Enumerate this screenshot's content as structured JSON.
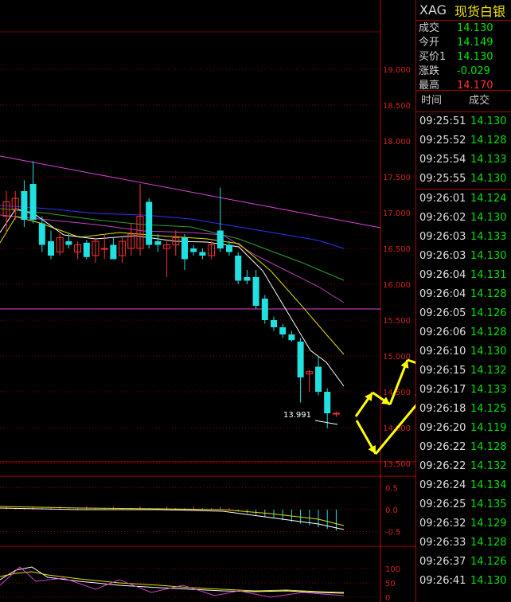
{
  "header": {
    "symbol": "XAG",
    "name": "现货白银"
  },
  "quotes": [
    {
      "label": "成交",
      "value": "14.130",
      "color": "#00e000"
    },
    {
      "label": "今开",
      "value": "14.149",
      "color": "#00e000"
    },
    {
      "label": "买价1",
      "value": "14.130",
      "color": "#00e000"
    },
    {
      "label": "涨跌",
      "value": "-0.029",
      "color": "#00e000"
    },
    {
      "label": "最高",
      "value": "14.170",
      "color": "#ff3030"
    }
  ],
  "ticks_header": {
    "time": "时间",
    "price": "成交"
  },
  "ticks": [
    {
      "time": "09:25:51",
      "price": "14.130"
    },
    {
      "time": "09:25:52",
      "price": "14.128"
    },
    {
      "time": "09:25:54",
      "price": "14.133"
    },
    {
      "time": "09:25:55",
      "price": "14.130"
    },
    {
      "time": "09:26:01",
      "price": "14.124"
    },
    {
      "time": "09:26:02",
      "price": "14.130"
    },
    {
      "time": "09:26:03",
      "price": "14.133"
    },
    {
      "time": "09:26:03",
      "price": "14.130"
    },
    {
      "time": "09:26:04",
      "price": "14.131"
    },
    {
      "time": "09:26:04",
      "price": "14.128"
    },
    {
      "time": "09:26:05",
      "price": "14.126"
    },
    {
      "time": "09:26:06",
      "price": "14.128"
    },
    {
      "time": "09:26:10",
      "price": "14.130"
    },
    {
      "time": "09:26:15",
      "price": "14.132"
    },
    {
      "time": "09:26:17",
      "price": "14.133"
    },
    {
      "time": "09:26:18",
      "price": "14.125"
    },
    {
      "time": "09:26:20",
      "price": "14.119"
    },
    {
      "time": "09:26:22",
      "price": "14.128"
    },
    {
      "time": "09:26:22",
      "price": "14.132"
    },
    {
      "time": "09:26:24",
      "price": "14.134"
    },
    {
      "time": "09:26:25",
      "price": "14.135"
    },
    {
      "time": "09:26:32",
      "price": "14.129"
    },
    {
      "time": "09:26:33",
      "price": "14.128"
    },
    {
      "time": "09:26:37",
      "price": "14.126"
    },
    {
      "time": "09:26:41",
      "price": "14.130"
    }
  ],
  "chart": {
    "price_axis": [
      "19.000",
      "18.500",
      "18.000",
      "17.500",
      "17.000",
      "16.500",
      "16.000",
      "15.500",
      "15.000",
      "14.500",
      "14.000",
      "13.500"
    ],
    "low_annotation": "13.991",
    "macd_axis": [
      "0.5",
      "0.0",
      "-0.5"
    ],
    "osc_axis": [
      "100",
      "50",
      "0"
    ],
    "candles": [
      [
        16.95,
        17.15,
        16.7,
        17.3
      ],
      [
        17.05,
        17.2,
        16.9,
        17.3
      ],
      [
        17.3,
        16.9,
        16.8,
        17.45
      ],
      [
        17.4,
        16.9,
        16.85,
        17.72
      ],
      [
        16.85,
        16.55,
        16.45,
        16.95
      ],
      [
        16.6,
        16.4,
        16.35,
        16.75
      ],
      [
        16.45,
        16.65,
        16.4,
        16.7
      ],
      [
        16.6,
        16.55,
        16.5,
        16.7
      ],
      [
        16.45,
        16.55,
        16.35,
        16.6
      ],
      [
        16.58,
        16.38,
        16.35,
        16.62
      ],
      [
        16.4,
        16.6,
        16.3,
        16.65
      ],
      [
        16.5,
        16.5,
        16.35,
        16.7
      ],
      [
        16.55,
        16.35,
        16.35,
        16.65
      ],
      [
        16.4,
        16.6,
        16.3,
        16.65
      ],
      [
        16.5,
        16.7,
        16.4,
        16.85
      ],
      [
        16.5,
        16.95,
        16.4,
        17.4
      ],
      [
        17.15,
        16.55,
        16.5,
        17.2
      ],
      [
        16.6,
        16.55,
        16.45,
        16.7
      ],
      [
        16.5,
        16.55,
        16.1,
        16.6
      ],
      [
        16.55,
        16.65,
        16.4,
        16.75
      ],
      [
        16.65,
        16.35,
        16.2,
        16.7
      ],
      [
        16.5,
        16.45,
        16.4,
        16.55
      ],
      [
        16.45,
        16.4,
        16.35,
        16.5
      ],
      [
        16.4,
        16.55,
        16.35,
        16.6
      ],
      [
        16.75,
        16.5,
        16.45,
        17.35
      ],
      [
        16.55,
        16.45,
        16.4,
        16.6
      ],
      [
        16.4,
        16.05,
        16.0,
        16.45
      ],
      [
        16.1,
        16.05,
        16.0,
        16.2
      ],
      [
        16.1,
        15.7,
        15.65,
        16.2
      ],
      [
        15.8,
        15.5,
        15.45,
        15.85
      ],
      [
        15.5,
        15.4,
        15.35,
        15.55
      ],
      [
        15.4,
        15.3,
        15.25,
        15.45
      ],
      [
        15.3,
        15.22,
        15.2,
        15.35
      ],
      [
        15.2,
        14.7,
        14.35,
        15.25
      ],
      [
        14.75,
        14.78,
        14.5,
        14.8
      ],
      [
        14.85,
        14.5,
        14.45,
        15.0
      ],
      [
        14.5,
        14.2,
        13.99,
        14.55
      ],
      [
        14.2,
        14.2,
        14.15,
        14.22
      ]
    ]
  }
}
